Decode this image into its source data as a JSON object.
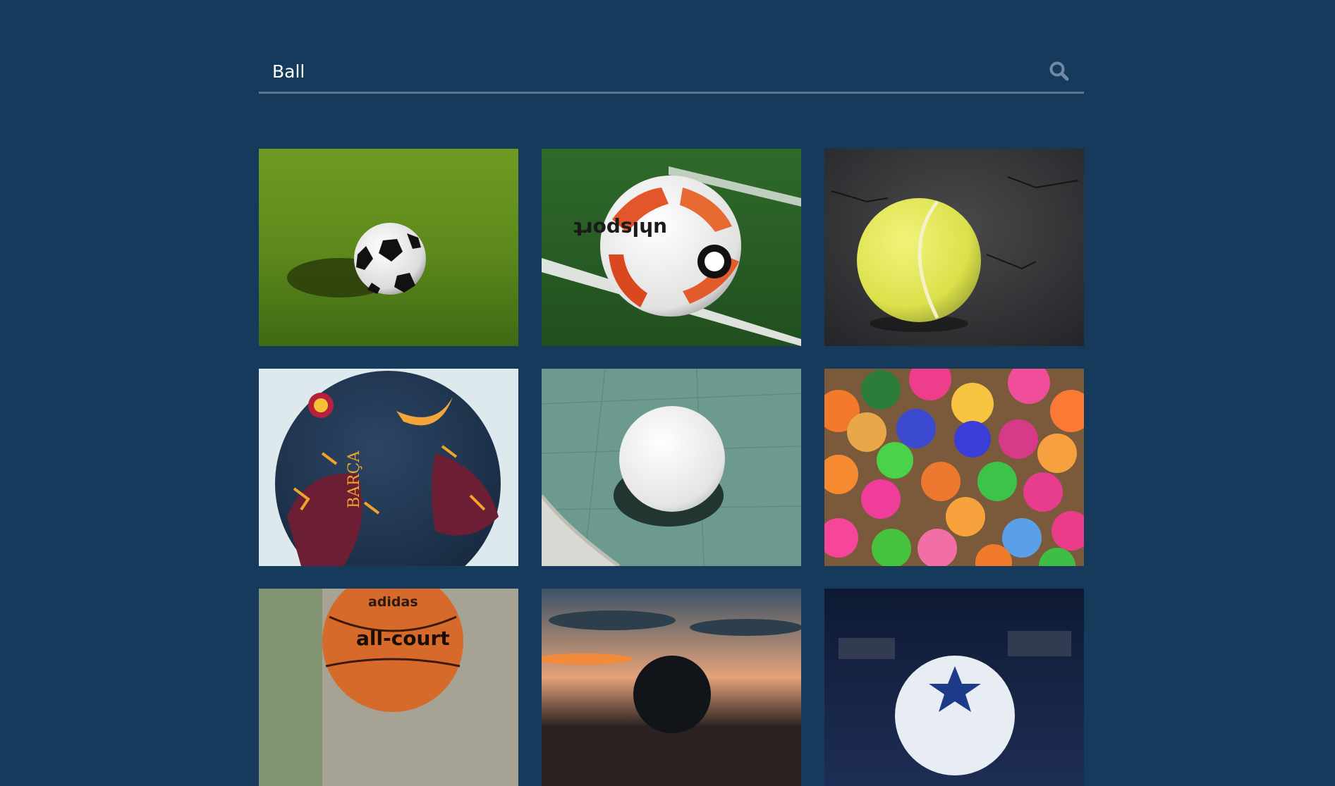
{
  "search": {
    "value": "Ball",
    "placeholder": "Search",
    "icon": "search-icon"
  },
  "colors": {
    "background": "#163a5c",
    "underline": "#5b7794",
    "icon": "#6f8aa6"
  },
  "results": [
    {
      "subject": "soccer-ball-on-grass"
    },
    {
      "subject": "uhlsport-soccer-ball-on-field"
    },
    {
      "subject": "tennis-ball-on-asphalt"
    },
    {
      "subject": "barca-nike-soccer-ball"
    },
    {
      "subject": "white-ball-on-court"
    },
    {
      "subject": "colorful-ball-pit"
    },
    {
      "subject": "adidas-basketball"
    },
    {
      "subject": "ball-at-sunset"
    },
    {
      "subject": "champions-league-ball"
    }
  ],
  "labels": {
    "nike_ball_text": "BARÇA",
    "uhlsport_text": "uhlsport",
    "adidas_brand": "adidas",
    "adidas_model": "all-court"
  }
}
